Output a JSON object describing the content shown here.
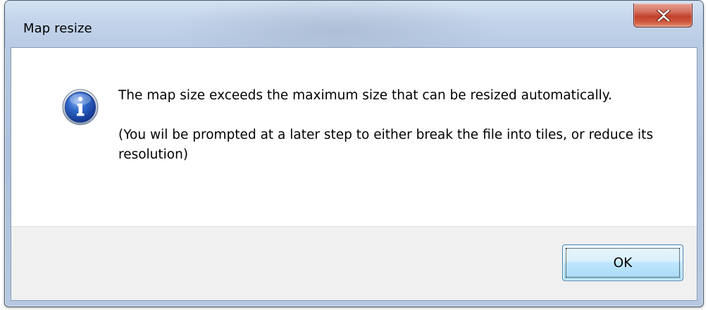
{
  "window": {
    "title": "Map resize"
  },
  "titlebar": {
    "close_icon": "close-x-icon"
  },
  "message": {
    "icon": "information-icon",
    "line1": "The map size exceeds the maximum size that can be resized automatically.",
    "line2": "(You wil be prompted at a later step to either break the file into tiles, or reduce its resolution)"
  },
  "footer": {
    "ok_label": "OK"
  },
  "colors": {
    "close_button": "#c2412b",
    "info_icon_blue": "#1f4fb5",
    "content_background": "#ffffff",
    "footer_background": "#f0f0f0",
    "ok_button_border": "#3c7fb1"
  }
}
